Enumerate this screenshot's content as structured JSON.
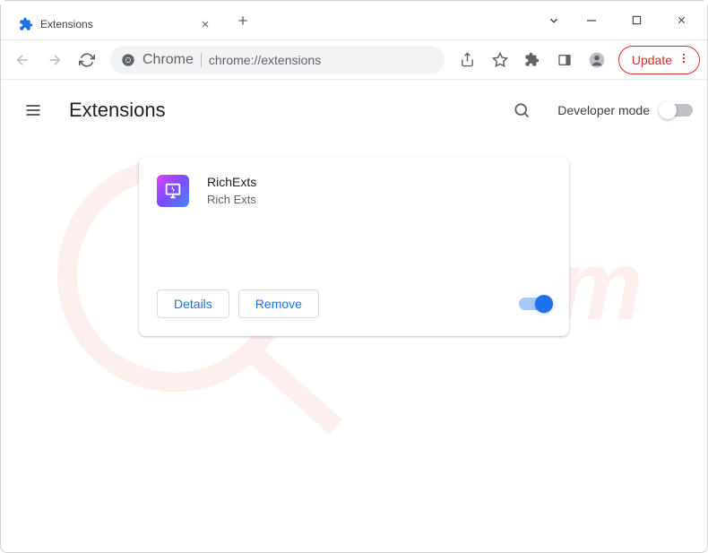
{
  "tab": {
    "title": "Extensions"
  },
  "address": {
    "protocol": "Chrome",
    "url": "chrome://extensions"
  },
  "update": {
    "label": "Update"
  },
  "page": {
    "title": "Extensions",
    "devmode_label": "Developer mode"
  },
  "extension": {
    "name": "RichExts",
    "description": "Rich Exts",
    "details_label": "Details",
    "remove_label": "Remove",
    "enabled": true
  }
}
